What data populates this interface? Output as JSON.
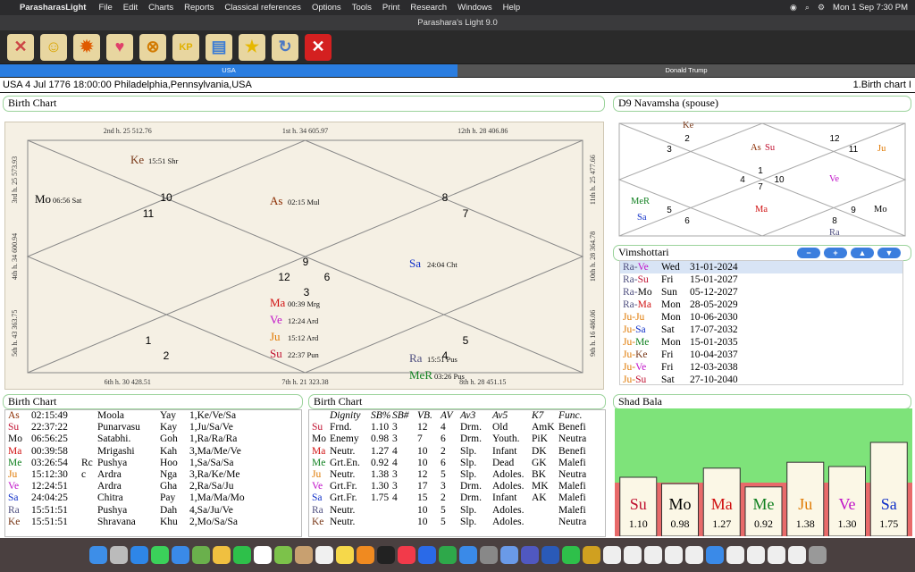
{
  "menubar": {
    "app_name": "ParasharasLight",
    "items": [
      "File",
      "Edit",
      "Charts",
      "Reports",
      "Classical references",
      "Options",
      "Tools",
      "Print",
      "Research",
      "Windows",
      "Help"
    ],
    "clock": "Mon 1 Sep  7:30 PM"
  },
  "window": {
    "title": "Parashara's Light 9.0"
  },
  "toolbar": {
    "buttons": [
      {
        "icon": "tools-icon",
        "color": "#c44"
      },
      {
        "icon": "person-icon",
        "color": "#d9a400"
      },
      {
        "icon": "sun-icon",
        "color": "#e05a00"
      },
      {
        "icon": "heart-icon",
        "color": "#e0406a"
      },
      {
        "icon": "chart-grid-icon",
        "color": "#d27a00"
      },
      {
        "icon": "kp-icon",
        "label": "KP",
        "color": "#e0b000"
      },
      {
        "icon": "report-icon",
        "color": "#3a7bd5"
      },
      {
        "icon": "star-icon",
        "color": "#e6b800"
      },
      {
        "icon": "refresh-icon",
        "color": "#4a78c4"
      },
      {
        "icon": "close-icon",
        "color": "#d42020"
      }
    ]
  },
  "tabs": [
    {
      "label": "USA",
      "active": true
    },
    {
      "label": "Donald Trump",
      "active": false
    }
  ],
  "info": {
    "left": "USA 4 Jul 1776 18:00:00  Philadelphia,Pennsylvania,USA",
    "right": "1.Birth chart I"
  },
  "birth_chart": {
    "title": "Birth Chart",
    "houses_top": [
      "2nd h.  25  512.76",
      "1st h.  34  605.97",
      "12th h.  28  406.86"
    ],
    "houses_bottom": [
      "6th h.  30  428.51",
      "7th h.  21  323.38",
      "8th h.  28  451.15"
    ],
    "houses_left": [
      "3rd h.  25  573.93",
      "4th h.  34  600.94",
      "5th h.  43  363.75"
    ],
    "houses_right": [
      "11th h.  25  477.66",
      "10th h.  28  364.78",
      "9th h.  16  486.06"
    ],
    "signs": [
      "10",
      "11",
      "8",
      "7",
      "9",
      "12",
      "6",
      "3",
      "1",
      "2",
      "4",
      "5"
    ],
    "planets": [
      {
        "abbr": "Ke",
        "deg": "15:51 Shr",
        "color": "#7a3a1a"
      },
      {
        "abbr": "Mo",
        "deg": "06:56 Sat",
        "color": "#000"
      },
      {
        "abbr": "As",
        "deg": "02:15 Mul",
        "color": "#8b2c00"
      },
      {
        "abbr": "Sa",
        "deg": "24:04 Cht",
        "color": "#1030c8"
      },
      {
        "abbr": "Ma",
        "deg": "00:39 Mrg",
        "color": "#d01010"
      },
      {
        "abbr": "Ve",
        "deg": "12:24 Ard",
        "color": "#c010c8"
      },
      {
        "abbr": "Ju",
        "deg": "15:12 Ard",
        "color": "#e07800"
      },
      {
        "abbr": "Su",
        "deg": "22:37 Pun",
        "color": "#c01030"
      },
      {
        "abbr": "Ra",
        "deg": "15:51 Pus",
        "color": "#505080"
      },
      {
        "abbr": "MeR",
        "deg": "03:26 Pus",
        "color": "#108020"
      }
    ]
  },
  "navamsha": {
    "title": "D9 Navamsha  (spouse)",
    "signs": [
      "2",
      "3",
      "12",
      "11",
      "1",
      "4",
      "10",
      "7",
      "5",
      "6",
      "8",
      "9"
    ],
    "planets": [
      {
        "abbr": "Ke",
        "color": "#7a3a1a"
      },
      {
        "abbr": "As",
        "color": "#8b2c00"
      },
      {
        "abbr": "Su",
        "color": "#c01030"
      },
      {
        "abbr": "Ju",
        "color": "#e07800"
      },
      {
        "abbr": "Ve",
        "color": "#c010c8"
      },
      {
        "abbr": "MeR",
        "color": "#108020"
      },
      {
        "abbr": "Sa",
        "color": "#1030c8"
      },
      {
        "abbr": "Ma",
        "color": "#d01010"
      },
      {
        "abbr": "Mo",
        "color": "#000"
      },
      {
        "abbr": "Ra",
        "color": "#505080"
      }
    ]
  },
  "vimshottari": {
    "title": "Vimshottari",
    "buttons": [
      "−",
      "+",
      "▲",
      "▼"
    ],
    "rows": [
      {
        "p1": "Ra",
        "p2": "Ve",
        "c1": "#505080",
        "c2": "#c010c8",
        "day": "Wed",
        "date": "31-01-2024",
        "selected": true
      },
      {
        "p1": "Ra",
        "p2": "Su",
        "c1": "#505080",
        "c2": "#c01030",
        "day": "Fri",
        "date": "15-01-2027"
      },
      {
        "p1": "Ra",
        "p2": "Mo",
        "c1": "#505080",
        "c2": "#000",
        "day": "Sun",
        "date": "05-12-2027"
      },
      {
        "p1": "Ra",
        "p2": "Ma",
        "c1": "#505080",
        "c2": "#d01010",
        "day": "Mon",
        "date": "28-05-2029"
      },
      {
        "p1": "Ju",
        "p2": "Ju",
        "c1": "#e07800",
        "c2": "#e07800",
        "day": "Mon",
        "date": "10-06-2030"
      },
      {
        "p1": "Ju",
        "p2": "Sa",
        "c1": "#e07800",
        "c2": "#1030c8",
        "day": "Sat",
        "date": "17-07-2032"
      },
      {
        "p1": "Ju",
        "p2": "Me",
        "c1": "#e07800",
        "c2": "#108020",
        "day": "Mon",
        "date": "15-01-2035"
      },
      {
        "p1": "Ju",
        "p2": "Ke",
        "c1": "#e07800",
        "c2": "#7a3a1a",
        "day": "Fri",
        "date": "10-04-2037"
      },
      {
        "p1": "Ju",
        "p2": "Ve",
        "c1": "#e07800",
        "c2": "#c010c8",
        "day": "Fri",
        "date": "12-03-2038"
      },
      {
        "p1": "Ju",
        "p2": "Su",
        "c1": "#e07800",
        "c2": "#c01030",
        "day": "Sat",
        "date": "27-10-2040"
      }
    ]
  },
  "positions_table": {
    "title": "Birth Chart",
    "rows": [
      {
        "p": "As",
        "color": "#8b2c00",
        "deg": "02:15:49",
        "flag": "",
        "nak": "Moola",
        "pada": "Yay",
        "lord": "1,Ke/Ve/Sa"
      },
      {
        "p": "Su",
        "color": "#c01030",
        "deg": "22:37:22",
        "flag": "",
        "nak": "Punarvasu",
        "pada": "Kay",
        "lord": "1,Ju/Sa/Ve"
      },
      {
        "p": "Mo",
        "color": "#000",
        "deg": "06:56:25",
        "flag": "",
        "nak": "Satabhi.",
        "pada": "Goh",
        "lord": "1,Ra/Ra/Ra"
      },
      {
        "p": "Ma",
        "color": "#d01010",
        "deg": "00:39:58",
        "flag": "",
        "nak": "Mrigashi",
        "pada": "Kah",
        "lord": "3,Ma/Me/Ve"
      },
      {
        "p": "Me",
        "color": "#108020",
        "deg": "03:26:54",
        "flag": "Rc",
        "nak": "Pushya",
        "pada": "Hoo",
        "lord": "1,Sa/Sa/Sa"
      },
      {
        "p": "Ju",
        "color": "#e07800",
        "deg": "15:12:30",
        "flag": "c",
        "nak": "Ardra",
        "pada": "Nga",
        "lord": "3,Ra/Ke/Me"
      },
      {
        "p": "Ve",
        "color": "#c010c8",
        "deg": "12:24:51",
        "flag": "",
        "nak": "Ardra",
        "pada": "Gha",
        "lord": "2,Ra/Sa/Ju"
      },
      {
        "p": "Sa",
        "color": "#1030c8",
        "deg": "24:04:25",
        "flag": "",
        "nak": "Chitra",
        "pada": "Pay",
        "lord": "1,Ma/Ma/Mo"
      },
      {
        "p": "Ra",
        "color": "#505080",
        "deg": "15:51:51",
        "flag": "",
        "nak": "Pushya",
        "pada": "Dah",
        "lord": "4,Sa/Ju/Ve"
      },
      {
        "p": "Ke",
        "color": "#7a3a1a",
        "deg": "15:51:51",
        "flag": "",
        "nak": "Shravana",
        "pada": "Khu",
        "lord": "2,Mo/Sa/Sa"
      }
    ]
  },
  "dignity_table": {
    "title": "Birth Chart",
    "headers": [
      "Dignity",
      "SB%",
      "SB#",
      "VB.",
      "AV",
      "Av3",
      "Av5",
      "K7",
      "Func."
    ],
    "rows": [
      {
        "p": "Su",
        "color": "#c01030",
        "cells": [
          "Frnd.",
          "1.10",
          "3",
          "12",
          "4",
          "Drm.",
          "Old",
          "AmK",
          "Benefi"
        ]
      },
      {
        "p": "Mo",
        "color": "#000",
        "cells": [
          "Enemy",
          "0.98",
          "3",
          "7",
          "6",
          "Drm.",
          "Youth.",
          "PiK",
          "Neutra"
        ]
      },
      {
        "p": "Ma",
        "color": "#d01010",
        "cells": [
          "Neutr.",
          "1.27",
          "4",
          "10",
          "2",
          "Slp.",
          "Infant",
          "DK",
          "Benefi"
        ]
      },
      {
        "p": "Me",
        "color": "#108020",
        "cells": [
          "Grt.En.",
          "0.92",
          "4",
          "10",
          "6",
          "Slp.",
          "Dead",
          "GK",
          "Malefi"
        ]
      },
      {
        "p": "Ju",
        "color": "#e07800",
        "cells": [
          "Neutr.",
          "1.38",
          "3",
          "12",
          "5",
          "Slp.",
          "Adoles.",
          "BK",
          "Neutra"
        ]
      },
      {
        "p": "Ve",
        "color": "#c010c8",
        "cells": [
          "Grt.Fr.",
          "1.30",
          "3",
          "17",
          "3",
          "Drm.",
          "Adoles.",
          "MK",
          "Malefi"
        ]
      },
      {
        "p": "Sa",
        "color": "#1030c8",
        "cells": [
          "Grt.Fr.",
          "1.75",
          "4",
          "15",
          "2",
          "Drm.",
          "Infant",
          "AK",
          "Malefi"
        ]
      },
      {
        "p": "Ra",
        "color": "#505080",
        "cells": [
          "Neutr.",
          "",
          "",
          "10",
          "5",
          "Slp.",
          "Adoles.",
          "",
          "Malefi"
        ]
      },
      {
        "p": "Ke",
        "color": "#7a3a1a",
        "cells": [
          "Neutr.",
          "",
          "",
          "10",
          "5",
          "Slp.",
          "Adoles.",
          "",
          "Neutra"
        ]
      }
    ]
  },
  "shad_bala": {
    "title": "Shad Bala",
    "chart_data": {
      "type": "bar",
      "categories": [
        "Su",
        "Mo",
        "Ma",
        "Me",
        "Ju",
        "Ve",
        "Sa"
      ],
      "values": [
        1.1,
        0.98,
        1.27,
        0.92,
        1.38,
        1.3,
        1.75
      ],
      "labels": [
        "1.10",
        "0.98",
        "1.27",
        "0.92",
        "1.38",
        "1.30",
        "1.75"
      ],
      "colors": [
        "#c01030",
        "#000000",
        "#d01010",
        "#108020",
        "#e07800",
        "#c010c8",
        "#1030c8"
      ],
      "threshold": 1.0,
      "above_color": "#7ee37a",
      "below_color": "#e86a6a"
    }
  },
  "dock": {
    "icons": [
      "finder-icon",
      "launchpad-icon",
      "safari-icon",
      "messages-icon",
      "mail-icon",
      "maps-icon",
      "photos-icon",
      "facetime-icon",
      "calendar-icon",
      "android-icon",
      "contacts-icon",
      "reminders-icon",
      "notes-icon",
      "pages-icon",
      "tv-icon",
      "music-icon",
      "keynote-icon",
      "numbers-icon",
      "appstore-icon",
      "settings-icon",
      "preview-icon",
      "teams-icon",
      "word-icon",
      "whatsapp-icon",
      "parashara-icon",
      "doc-icon",
      "doc-icon",
      "doc-icon",
      "doc-icon",
      "doc-icon",
      "globe-icon",
      "doc-icon",
      "doc-icon",
      "doc-icon",
      "doc-icon",
      "trash-icon"
    ],
    "colors": [
      "#3d8ee8",
      "#bbb",
      "#2e86e8",
      "#3bd15a",
      "#3a8ae8",
      "#6ab04c",
      "#f0c040",
      "#2ec04a",
      "#fff",
      "#7cc24a",
      "#c8a070",
      "#f0f0f0",
      "#f6d84a",
      "#f08a20",
      "#222",
      "#f23a4a",
      "#2a6ae8",
      "#2ea84a",
      "#3a8ae8",
      "#888",
      "#6a9ae8",
      "#5058c0",
      "#2a5ab8",
      "#2ec04a",
      "#d0a020",
      "#eee",
      "#eee",
      "#eee",
      "#eee",
      "#eee",
      "#3a8ae8",
      "#eee",
      "#eee",
      "#eee",
      "#eee",
      "#999"
    ]
  }
}
